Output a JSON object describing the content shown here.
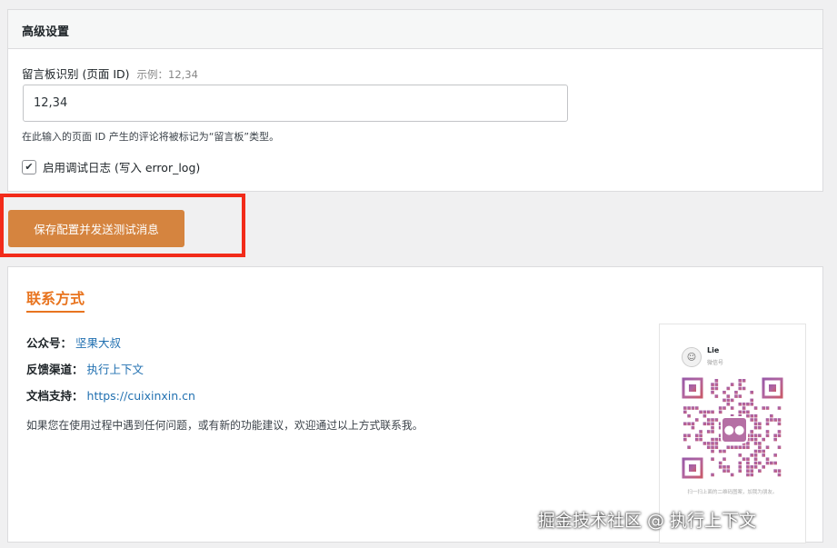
{
  "advanced": {
    "title": "高级设置",
    "board_label": "留言板识别 (页面 ID)",
    "board_hint": "示例：12,34",
    "board_value": "12,34",
    "board_desc": "在此输入的页面 ID 产生的评论将被标记为“留言板”类型。",
    "debug_label": "启用调试日志 (写入 error_log)",
    "debug_checked": true
  },
  "save_button": "保存配置并发送测试消息",
  "contact": {
    "title": "联系方式",
    "rows": [
      {
        "key": "公众号：",
        "value": "坚果大叔"
      },
      {
        "key": "反馈渠道：",
        "value": "执行上下文"
      },
      {
        "key": "文档支持：",
        "value": "https://cuixinxin.cn"
      }
    ],
    "note": "如果您在使用过程中遇到任何问题，或有新的功能建议，欢迎通过以上方式联系我。",
    "qr_name": "Lie",
    "qr_sub": "微信号",
    "qr_footer": "扫一扫上面的二维码图案，加我为朋友。"
  },
  "watermark": "掘金技术社区 @ 执行上下文",
  "colors": {
    "accent": "#d5843f",
    "title_orange": "#e8741f",
    "link": "#2271b1",
    "highlight": "#f22b1a"
  }
}
